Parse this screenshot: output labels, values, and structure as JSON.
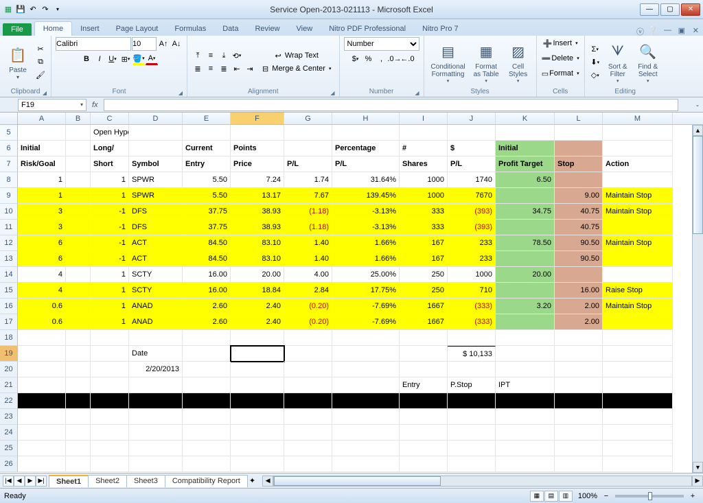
{
  "window": {
    "title": "Service Open-2013-021113 - Microsoft Excel"
  },
  "tabs": {
    "file": "File",
    "items": [
      "Home",
      "Insert",
      "Page Layout",
      "Formulas",
      "Data",
      "Review",
      "View",
      "Nitro PDF Professional",
      "Nitro Pro 7"
    ],
    "active": "Home"
  },
  "ribbon": {
    "clipboard": {
      "label": "Clipboard",
      "paste": "Paste"
    },
    "font": {
      "label": "Font",
      "name": "Calibri",
      "size": "10"
    },
    "alignment": {
      "label": "Alignment",
      "wrap": "Wrap Text",
      "merge": "Merge & Center"
    },
    "number": {
      "label": "Number",
      "format": "Number"
    },
    "styles": {
      "label": "Styles",
      "cond": "Conditional\nFormatting",
      "table": "Format\nas Table",
      "cell": "Cell\nStyles"
    },
    "cells": {
      "label": "Cells",
      "insert": "Insert",
      "delete": "Delete",
      "format": "Format"
    },
    "editing": {
      "label": "Editing",
      "sort": "Sort &\nFilter",
      "find": "Find &\nSelect"
    }
  },
  "namebox": "F19",
  "columns": [
    "A",
    "B",
    "C",
    "D",
    "E",
    "F",
    "G",
    "H",
    "I",
    "J",
    "K",
    "L",
    "M"
  ],
  "rowstart": 5,
  "rows_visible": 22,
  "headers1": {
    "A": "Initial",
    "C": "Long/",
    "E": "Current",
    "F": "Points",
    "H": "Percentage",
    "I": "#",
    "J": "$",
    "K": "Initial"
  },
  "headers2": {
    "A": "Risk/Goal",
    "C": "Short",
    "D": "Symbol",
    "E": "Entry",
    "F": "Price",
    "G": "P/L",
    "H": "P/L",
    "I": "Shares",
    "J": "P/L",
    "K": "Profit Target",
    "L": "Stop",
    "M": "Action"
  },
  "portfolio_title": "Open Hypothetical Portfolio*",
  "data_rows": [
    {
      "y": false,
      "A": "1",
      "C": "1",
      "D": "SPWR",
      "E": "5.50",
      "F": "7.24",
      "G": "1.74",
      "H": "31.64%",
      "I": "1000",
      "J": "1740",
      "K": "6.50",
      "L": "",
      "M": ""
    },
    {
      "y": true,
      "A": "1",
      "C": "1",
      "D": "SPWR",
      "E": "5.50",
      "F": "13.17",
      "G": "7.67",
      "H": "139.45%",
      "I": "1000",
      "J": "7670",
      "K": "",
      "L": "9.00",
      "M": "Maintain Stop"
    },
    {
      "y": true,
      "A": "3",
      "C": "-1",
      "D": "DFS",
      "E": "37.75",
      "F": "38.93",
      "G": "(1.18)",
      "Gneg": true,
      "H": "-3.13%",
      "I": "333",
      "J": "(393)",
      "Jneg": true,
      "K": "34.75",
      "L": "40.75",
      "M": "Maintain Stop"
    },
    {
      "y": true,
      "A": "3",
      "C": "-1",
      "D": "DFS",
      "E": "37.75",
      "F": "38.93",
      "G": "(1.18)",
      "Gneg": true,
      "H": "-3.13%",
      "I": "333",
      "J": "(393)",
      "Jneg": true,
      "K": "",
      "L": "40.75",
      "M": ""
    },
    {
      "y": true,
      "A": "6",
      "C": "-1",
      "D": "ACT",
      "E": "84.50",
      "F": "83.10",
      "G": "1.40",
      "H": "1.66%",
      "I": "167",
      "J": "233",
      "K": "78.50",
      "L": "90.50",
      "M": "Maintain Stop"
    },
    {
      "y": true,
      "A": "6",
      "C": "-1",
      "D": "ACT",
      "E": "84.50",
      "F": "83.10",
      "G": "1.40",
      "H": "1.66%",
      "I": "167",
      "J": "233",
      "K": "",
      "L": "90.50",
      "M": ""
    },
    {
      "y": false,
      "A": "4",
      "C": "1",
      "D": "SCTY",
      "E": "16.00",
      "F": "20.00",
      "G": "4.00",
      "H": "25.00%",
      "I": "250",
      "J": "1000",
      "K": "20.00",
      "L": "",
      "M": ""
    },
    {
      "y": true,
      "A": "4",
      "C": "1",
      "D": "SCTY",
      "E": "16.00",
      "F": "18.84",
      "G": "2.84",
      "H": "17.75%",
      "I": "250",
      "J": "710",
      "K": "",
      "L": "16.00",
      "M": "Raise Stop"
    },
    {
      "y": true,
      "A": "0.6",
      "C": "1",
      "D": "ANAD",
      "E": "2.60",
      "F": "2.40",
      "G": "(0.20)",
      "Gneg": true,
      "H": "-7.69%",
      "I": "1667",
      "J": "(333)",
      "Jneg": true,
      "K": "3.20",
      "L": "2.00",
      "M": "Maintain Stop"
    },
    {
      "y": true,
      "A": "0.6",
      "C": "1",
      "D": "ANAD",
      "E": "2.60",
      "F": "2.40",
      "G": "(0.20)",
      "Gneg": true,
      "H": "-7.69%",
      "I": "1667",
      "J": "(333)",
      "Jneg": true,
      "K": "",
      "L": "2.00",
      "M": ""
    }
  ],
  "date_label": "Date",
  "date_value": "2/20/2013",
  "total_prefix": "$",
  "total_value": "10,133",
  "footer_labels": {
    "I": "Entry",
    "J": "P.Stop",
    "K": "IPT"
  },
  "sheets": [
    "Sheet1",
    "Sheet2",
    "Sheet3",
    "Compatibility Report"
  ],
  "active_sheet": "Sheet1",
  "status": {
    "ready": "Ready",
    "zoom": "100%"
  }
}
